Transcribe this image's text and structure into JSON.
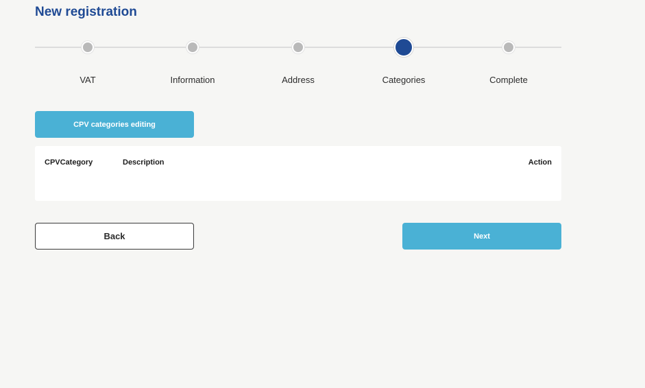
{
  "header": {
    "title": "New registration"
  },
  "stepper": {
    "active_index": 3,
    "steps": [
      {
        "label": "VAT"
      },
      {
        "label": "Information"
      },
      {
        "label": "Address"
      },
      {
        "label": "Categories"
      },
      {
        "label": "Complete"
      }
    ]
  },
  "categories": {
    "edit_button_label": "CPV categories editing",
    "table": {
      "columns": [
        "CPVCategory",
        "Description",
        "Action"
      ],
      "rows": []
    }
  },
  "navigation": {
    "back_label": "Back",
    "next_label": "Next"
  },
  "colors": {
    "title": "#1f4a94",
    "active_step": "#1f4a94",
    "inactive_step": "#b9b9b9",
    "primary_button": "#4ab1d5",
    "background": "#f6f6f4"
  }
}
